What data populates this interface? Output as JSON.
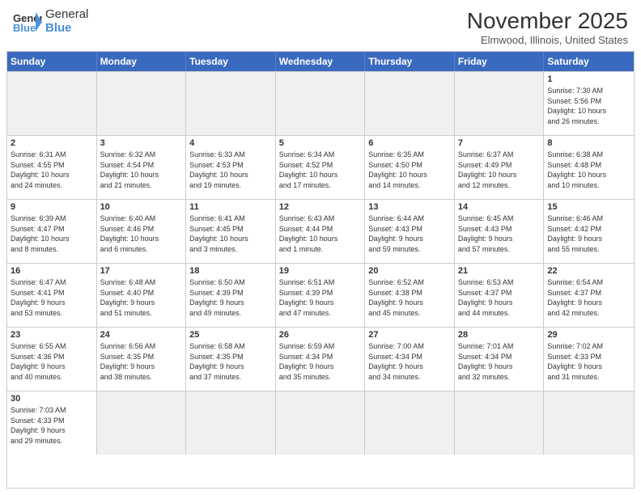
{
  "logo": {
    "text_general": "General",
    "text_blue": "Blue"
  },
  "title": "November 2025",
  "location": "Elmwood, Illinois, United States",
  "days_of_week": [
    "Sunday",
    "Monday",
    "Tuesday",
    "Wednesday",
    "Thursday",
    "Friday",
    "Saturday"
  ],
  "weeks": [
    [
      {
        "day": "",
        "info": "",
        "empty": true
      },
      {
        "day": "",
        "info": "",
        "empty": true
      },
      {
        "day": "",
        "info": "",
        "empty": true
      },
      {
        "day": "",
        "info": "",
        "empty": true
      },
      {
        "day": "",
        "info": "",
        "empty": true
      },
      {
        "day": "",
        "info": "",
        "empty": true
      },
      {
        "day": "1",
        "info": "Sunrise: 7:30 AM\nSunset: 5:56 PM\nDaylight: 10 hours\nand 26 minutes.",
        "empty": false
      }
    ],
    [
      {
        "day": "2",
        "info": "Sunrise: 6:31 AM\nSunset: 4:55 PM\nDaylight: 10 hours\nand 24 minutes.",
        "empty": false
      },
      {
        "day": "3",
        "info": "Sunrise: 6:32 AM\nSunset: 4:54 PM\nDaylight: 10 hours\nand 21 minutes.",
        "empty": false
      },
      {
        "day": "4",
        "info": "Sunrise: 6:33 AM\nSunset: 4:53 PM\nDaylight: 10 hours\nand 19 minutes.",
        "empty": false
      },
      {
        "day": "5",
        "info": "Sunrise: 6:34 AM\nSunset: 4:52 PM\nDaylight: 10 hours\nand 17 minutes.",
        "empty": false
      },
      {
        "day": "6",
        "info": "Sunrise: 6:35 AM\nSunset: 4:50 PM\nDaylight: 10 hours\nand 14 minutes.",
        "empty": false
      },
      {
        "day": "7",
        "info": "Sunrise: 6:37 AM\nSunset: 4:49 PM\nDaylight: 10 hours\nand 12 minutes.",
        "empty": false
      },
      {
        "day": "8",
        "info": "Sunrise: 6:38 AM\nSunset: 4:48 PM\nDaylight: 10 hours\nand 10 minutes.",
        "empty": false
      }
    ],
    [
      {
        "day": "9",
        "info": "Sunrise: 6:39 AM\nSunset: 4:47 PM\nDaylight: 10 hours\nand 8 minutes.",
        "empty": false
      },
      {
        "day": "10",
        "info": "Sunrise: 6:40 AM\nSunset: 4:46 PM\nDaylight: 10 hours\nand 6 minutes.",
        "empty": false
      },
      {
        "day": "11",
        "info": "Sunrise: 6:41 AM\nSunset: 4:45 PM\nDaylight: 10 hours\nand 3 minutes.",
        "empty": false
      },
      {
        "day": "12",
        "info": "Sunrise: 6:43 AM\nSunset: 4:44 PM\nDaylight: 10 hours\nand 1 minute.",
        "empty": false
      },
      {
        "day": "13",
        "info": "Sunrise: 6:44 AM\nSunset: 4:43 PM\nDaylight: 9 hours\nand 59 minutes.",
        "empty": false
      },
      {
        "day": "14",
        "info": "Sunrise: 6:45 AM\nSunset: 4:43 PM\nDaylight: 9 hours\nand 57 minutes.",
        "empty": false
      },
      {
        "day": "15",
        "info": "Sunrise: 6:46 AM\nSunset: 4:42 PM\nDaylight: 9 hours\nand 55 minutes.",
        "empty": false
      }
    ],
    [
      {
        "day": "16",
        "info": "Sunrise: 6:47 AM\nSunset: 4:41 PM\nDaylight: 9 hours\nand 53 minutes.",
        "empty": false
      },
      {
        "day": "17",
        "info": "Sunrise: 6:48 AM\nSunset: 4:40 PM\nDaylight: 9 hours\nand 51 minutes.",
        "empty": false
      },
      {
        "day": "18",
        "info": "Sunrise: 6:50 AM\nSunset: 4:39 PM\nDaylight: 9 hours\nand 49 minutes.",
        "empty": false
      },
      {
        "day": "19",
        "info": "Sunrise: 6:51 AM\nSunset: 4:39 PM\nDaylight: 9 hours\nand 47 minutes.",
        "empty": false
      },
      {
        "day": "20",
        "info": "Sunrise: 6:52 AM\nSunset: 4:38 PM\nDaylight: 9 hours\nand 45 minutes.",
        "empty": false
      },
      {
        "day": "21",
        "info": "Sunrise: 6:53 AM\nSunset: 4:37 PM\nDaylight: 9 hours\nand 44 minutes.",
        "empty": false
      },
      {
        "day": "22",
        "info": "Sunrise: 6:54 AM\nSunset: 4:37 PM\nDaylight: 9 hours\nand 42 minutes.",
        "empty": false
      }
    ],
    [
      {
        "day": "23",
        "info": "Sunrise: 6:55 AM\nSunset: 4:36 PM\nDaylight: 9 hours\nand 40 minutes.",
        "empty": false
      },
      {
        "day": "24",
        "info": "Sunrise: 6:56 AM\nSunset: 4:35 PM\nDaylight: 9 hours\nand 38 minutes.",
        "empty": false
      },
      {
        "day": "25",
        "info": "Sunrise: 6:58 AM\nSunset: 4:35 PM\nDaylight: 9 hours\nand 37 minutes.",
        "empty": false
      },
      {
        "day": "26",
        "info": "Sunrise: 6:59 AM\nSunset: 4:34 PM\nDaylight: 9 hours\nand 35 minutes.",
        "empty": false
      },
      {
        "day": "27",
        "info": "Sunrise: 7:00 AM\nSunset: 4:34 PM\nDaylight: 9 hours\nand 34 minutes.",
        "empty": false
      },
      {
        "day": "28",
        "info": "Sunrise: 7:01 AM\nSunset: 4:34 PM\nDaylight: 9 hours\nand 32 minutes.",
        "empty": false
      },
      {
        "day": "29",
        "info": "Sunrise: 7:02 AM\nSunset: 4:33 PM\nDaylight: 9 hours\nand 31 minutes.",
        "empty": false
      }
    ],
    [
      {
        "day": "30",
        "info": "Sunrise: 7:03 AM\nSunset: 4:33 PM\nDaylight: 9 hours\nand 29 minutes.",
        "empty": false
      },
      {
        "day": "",
        "info": "",
        "empty": true
      },
      {
        "day": "",
        "info": "",
        "empty": true
      },
      {
        "day": "",
        "info": "",
        "empty": true
      },
      {
        "day": "",
        "info": "",
        "empty": true
      },
      {
        "day": "",
        "info": "",
        "empty": true
      },
      {
        "day": "",
        "info": "",
        "empty": true
      }
    ]
  ]
}
